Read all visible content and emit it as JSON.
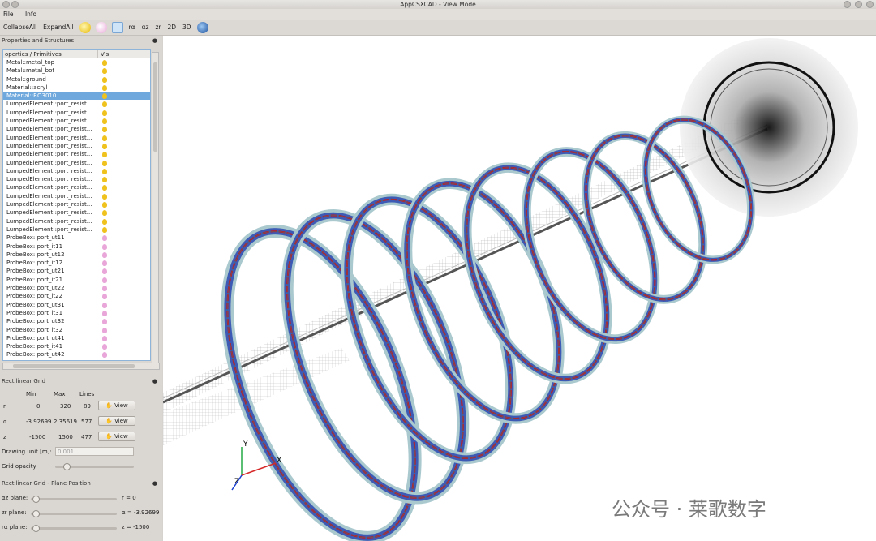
{
  "window": {
    "title": "AppCSXCAD - View Mode"
  },
  "menu": {
    "file": "File",
    "info": "Info"
  },
  "toolbar": {
    "collapse_all": "CollapseAll",
    "expand_all": "ExpandAll",
    "rz": "rα",
    "az": "αz",
    "zr": "zr",
    "2d": "2D",
    "3d": "3D"
  },
  "properties_panel": {
    "title": "Properties and Structures",
    "col_properties": "operties / Primitives",
    "col_vis": "Vis",
    "items": [
      {
        "label": "Metal::metal_top",
        "color": "#f0c21d"
      },
      {
        "label": "Metal::metal_bot",
        "color": "#f0c21d"
      },
      {
        "label": "Metal::ground",
        "color": "#f0c21d"
      },
      {
        "label": "Material::acryl",
        "color": "#f0c21d"
      },
      {
        "label": "Material::RO3010",
        "color": "#f0c21d",
        "selected": true
      },
      {
        "label": "LumpedElement::port_resist...",
        "color": "#f0c21d"
      },
      {
        "label": "LumpedElement::port_resist...",
        "color": "#f0c21d"
      },
      {
        "label": "LumpedElement::port_resist...",
        "color": "#f0c21d"
      },
      {
        "label": "LumpedElement::port_resist...",
        "color": "#f0c21d"
      },
      {
        "label": "LumpedElement::port_resist...",
        "color": "#f0c21d"
      },
      {
        "label": "LumpedElement::port_resist...",
        "color": "#f0c21d"
      },
      {
        "label": "LumpedElement::port_resist...",
        "color": "#f0c21d"
      },
      {
        "label": "LumpedElement::port_resist...",
        "color": "#f0c21d"
      },
      {
        "label": "LumpedElement::port_resist...",
        "color": "#f0c21d"
      },
      {
        "label": "LumpedElement::port_resist...",
        "color": "#f0c21d"
      },
      {
        "label": "LumpedElement::port_resist...",
        "color": "#f0c21d"
      },
      {
        "label": "LumpedElement::port_resist...",
        "color": "#f0c21d"
      },
      {
        "label": "LumpedElement::port_resist...",
        "color": "#f0c21d"
      },
      {
        "label": "LumpedElement::port_resist...",
        "color": "#f0c21d"
      },
      {
        "label": "LumpedElement::port_resist...",
        "color": "#f0c21d"
      },
      {
        "label": "LumpedElement::port_resist...",
        "color": "#f0c21d"
      },
      {
        "label": "ProbeBox::port_ut11",
        "color": "#e8a7d8"
      },
      {
        "label": "ProbeBox::port_it11",
        "color": "#e8a7d8"
      },
      {
        "label": "ProbeBox::port_ut12",
        "color": "#e8a7d8"
      },
      {
        "label": "ProbeBox::port_it12",
        "color": "#e8a7d8"
      },
      {
        "label": "ProbeBox::port_ut21",
        "color": "#e8a7d8"
      },
      {
        "label": "ProbeBox::port_it21",
        "color": "#e8a7d8"
      },
      {
        "label": "ProbeBox::port_ut22",
        "color": "#e8a7d8"
      },
      {
        "label": "ProbeBox::port_it22",
        "color": "#e8a7d8"
      },
      {
        "label": "ProbeBox::port_ut31",
        "color": "#e8a7d8"
      },
      {
        "label": "ProbeBox::port_it31",
        "color": "#e8a7d8"
      },
      {
        "label": "ProbeBox::port_ut32",
        "color": "#e8a7d8"
      },
      {
        "label": "ProbeBox::port_it32",
        "color": "#e8a7d8"
      },
      {
        "label": "ProbeBox::port_ut41",
        "color": "#e8a7d8"
      },
      {
        "label": "ProbeBox::port_it41",
        "color": "#e8a7d8"
      },
      {
        "label": "ProbeBox::port_ut42",
        "color": "#e8a7d8"
      }
    ]
  },
  "grid_panel": {
    "title": "Rectilinear Grid",
    "col_min": "Min",
    "col_max": "Max",
    "col_lines": "Lines",
    "rows": [
      {
        "axis": "r",
        "min": "0",
        "max": "320",
        "lines": "89",
        "button": "View"
      },
      {
        "axis": "α",
        "min": "-3.92699",
        "max": "2.35619",
        "lines": "577",
        "button": "View"
      },
      {
        "axis": "z",
        "min": "-1500",
        "max": "1500",
        "lines": "477",
        "button": "View"
      }
    ],
    "drawing_unit_label": "Drawing unit [m]:",
    "drawing_unit_value": "0.001",
    "grid_opacity_label": "Grid opacity"
  },
  "plane_panel": {
    "title": "Rectilinear Grid - Plane Position",
    "rows": [
      {
        "label": "αz plane:",
        "value": "r = 0"
      },
      {
        "label": "zr plane:",
        "value": "α = -3.92699"
      },
      {
        "label": "rα plane:",
        "value": "z = -1500"
      }
    ]
  },
  "axes": {
    "x": "X",
    "y": "Y",
    "z": "Z"
  },
  "watermark": "公众号 · 莱歌数字"
}
